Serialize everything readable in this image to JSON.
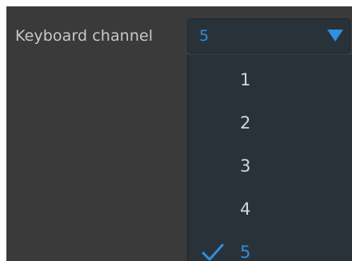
{
  "setting": {
    "label": "Keyboard channel"
  },
  "select": {
    "value": "5",
    "arrow_icon": "triangle-down-icon"
  },
  "menu": {
    "options": [
      {
        "label": "1",
        "selected": false
      },
      {
        "label": "2",
        "selected": false
      },
      {
        "label": "3",
        "selected": false
      },
      {
        "label": "4",
        "selected": false
      },
      {
        "label": "5",
        "selected": true
      }
    ],
    "check_icon": "checkmark-icon"
  },
  "colors": {
    "panel_bg": "#3a3a3b",
    "control_bg": "#2a3239",
    "accent": "#2f8fe0",
    "label_text": "#c9c9c9",
    "option_text": "#d4d7da"
  }
}
